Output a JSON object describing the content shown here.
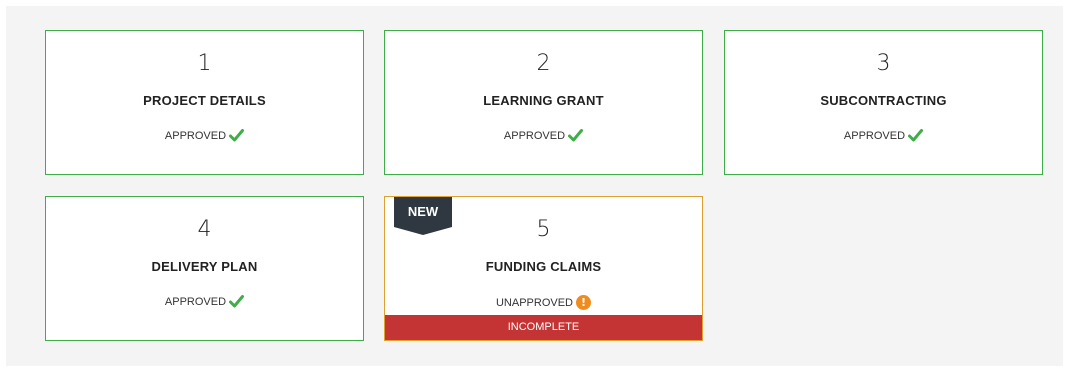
{
  "colors": {
    "panel_bg": "#f4f4f4",
    "approved_border": "#3fae49",
    "pending_border": "#e0a030",
    "check_green": "#3fae49",
    "warning_orange": "#f08c1e",
    "incomplete_red": "#c53434",
    "badge_dark": "#2f3740"
  },
  "steps": [
    {
      "number": "1",
      "title": "PROJECT DETAILS",
      "status": "APPROVED",
      "status_icon": "check-icon"
    },
    {
      "number": "2",
      "title": "LEARNING GRANT",
      "status": "APPROVED",
      "status_icon": "check-icon"
    },
    {
      "number": "3",
      "title": "SUBCONTRACTING",
      "status": "APPROVED",
      "status_icon": "check-icon"
    },
    {
      "number": "4",
      "title": "DELIVERY PLAN",
      "status": "APPROVED",
      "status_icon": "check-icon"
    },
    {
      "number": "5",
      "title": "FUNDING CLAIMS",
      "status": "UNAPPROVED",
      "status_icon": "warning-icon",
      "badge": "NEW",
      "footer": "INCOMPLETE"
    }
  ],
  "icons": {
    "warning_glyph": "!"
  }
}
